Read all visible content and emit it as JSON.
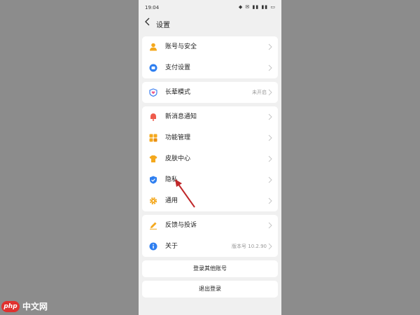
{
  "status_bar": {
    "time": "19:04",
    "icons": "◆ ✉ ▮▮ ▮▮ ▭"
  },
  "title_bar": {
    "title": "设置"
  },
  "group_account": [
    {
      "label": "账号与安全",
      "icon": "person-icon",
      "color": "#f4a81d"
    },
    {
      "label": "支付设置",
      "icon": "wallet-icon",
      "color": "#2f7ff0"
    }
  ],
  "group_mode": [
    {
      "label": "长辈模式",
      "value": "未开启",
      "icon": "heart-shield-icon",
      "color": "#3b7ef0"
    }
  ],
  "group_features": [
    {
      "label": "新消息通知",
      "icon": "bell-icon",
      "color": "#ee5b4c"
    },
    {
      "label": "功能管理",
      "icon": "grid-icon",
      "color": "#f4a81d"
    },
    {
      "label": "皮肤中心",
      "icon": "shirt-icon",
      "color": "#f4a81d"
    },
    {
      "label": "隐私",
      "icon": "shield-icon",
      "color": "#2f7ff0"
    },
    {
      "label": "通用",
      "icon": "gear-icon",
      "color": "#f4a81d"
    }
  ],
  "group_about": [
    {
      "label": "反馈与投诉",
      "icon": "pencil-icon",
      "color": "#f4a81d"
    },
    {
      "label": "关于",
      "value": "版本号 10.2.90",
      "icon": "info-icon",
      "color": "#2f7ff0"
    }
  ],
  "buttons": {
    "login_other": "登录其他账号",
    "logout": "退出登录"
  },
  "watermark": {
    "logo": "php",
    "text": "中文网"
  },
  "colors": {
    "annotation_arrow": "#c0282a",
    "background": "#8c8c8c",
    "screen": "#f0f0f0"
  }
}
